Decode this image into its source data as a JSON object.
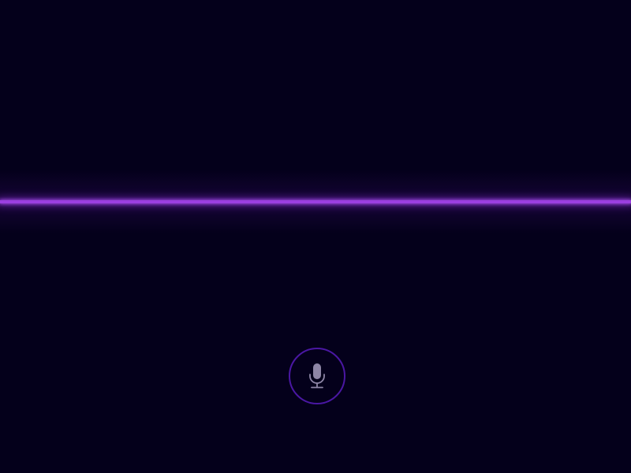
{
  "app": {
    "state": "listening"
  },
  "waveform": {
    "color": "#9b3fe0",
    "level": 0
  },
  "mic_button": {
    "icon": "microphone-icon",
    "border_color": "#4a17a3",
    "icon_color": "#8e86a6"
  },
  "colors": {
    "background": "#04001b"
  }
}
